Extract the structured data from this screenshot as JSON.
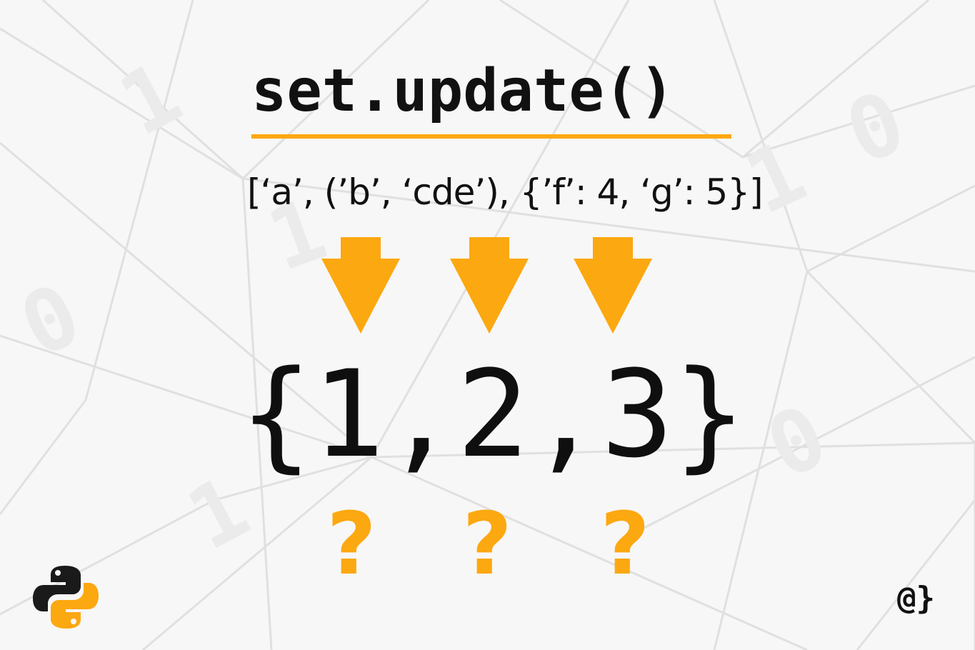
{
  "title": "set.update()",
  "iterables_text": "[‘a’,  (’b’, ‘cde’),  {’f’: 4, ‘g’: 5}]",
  "set_literal": "{1,2,3}",
  "question_marks": [
    "?",
    "?",
    "?"
  ],
  "brand_mark": "@}",
  "background_digits": [
    "1",
    "1",
    "1",
    "0",
    "0",
    "1",
    "0"
  ],
  "colors": {
    "accent": "#fca810",
    "text": "#111111",
    "background": "#f7f7f7",
    "network_lines": "#dedede",
    "python_blue": "#1a1a1a",
    "python_yellow": "#fca810"
  },
  "icons": {
    "arrow": "down-arrow-icon",
    "logo": "python-logo-icon"
  }
}
